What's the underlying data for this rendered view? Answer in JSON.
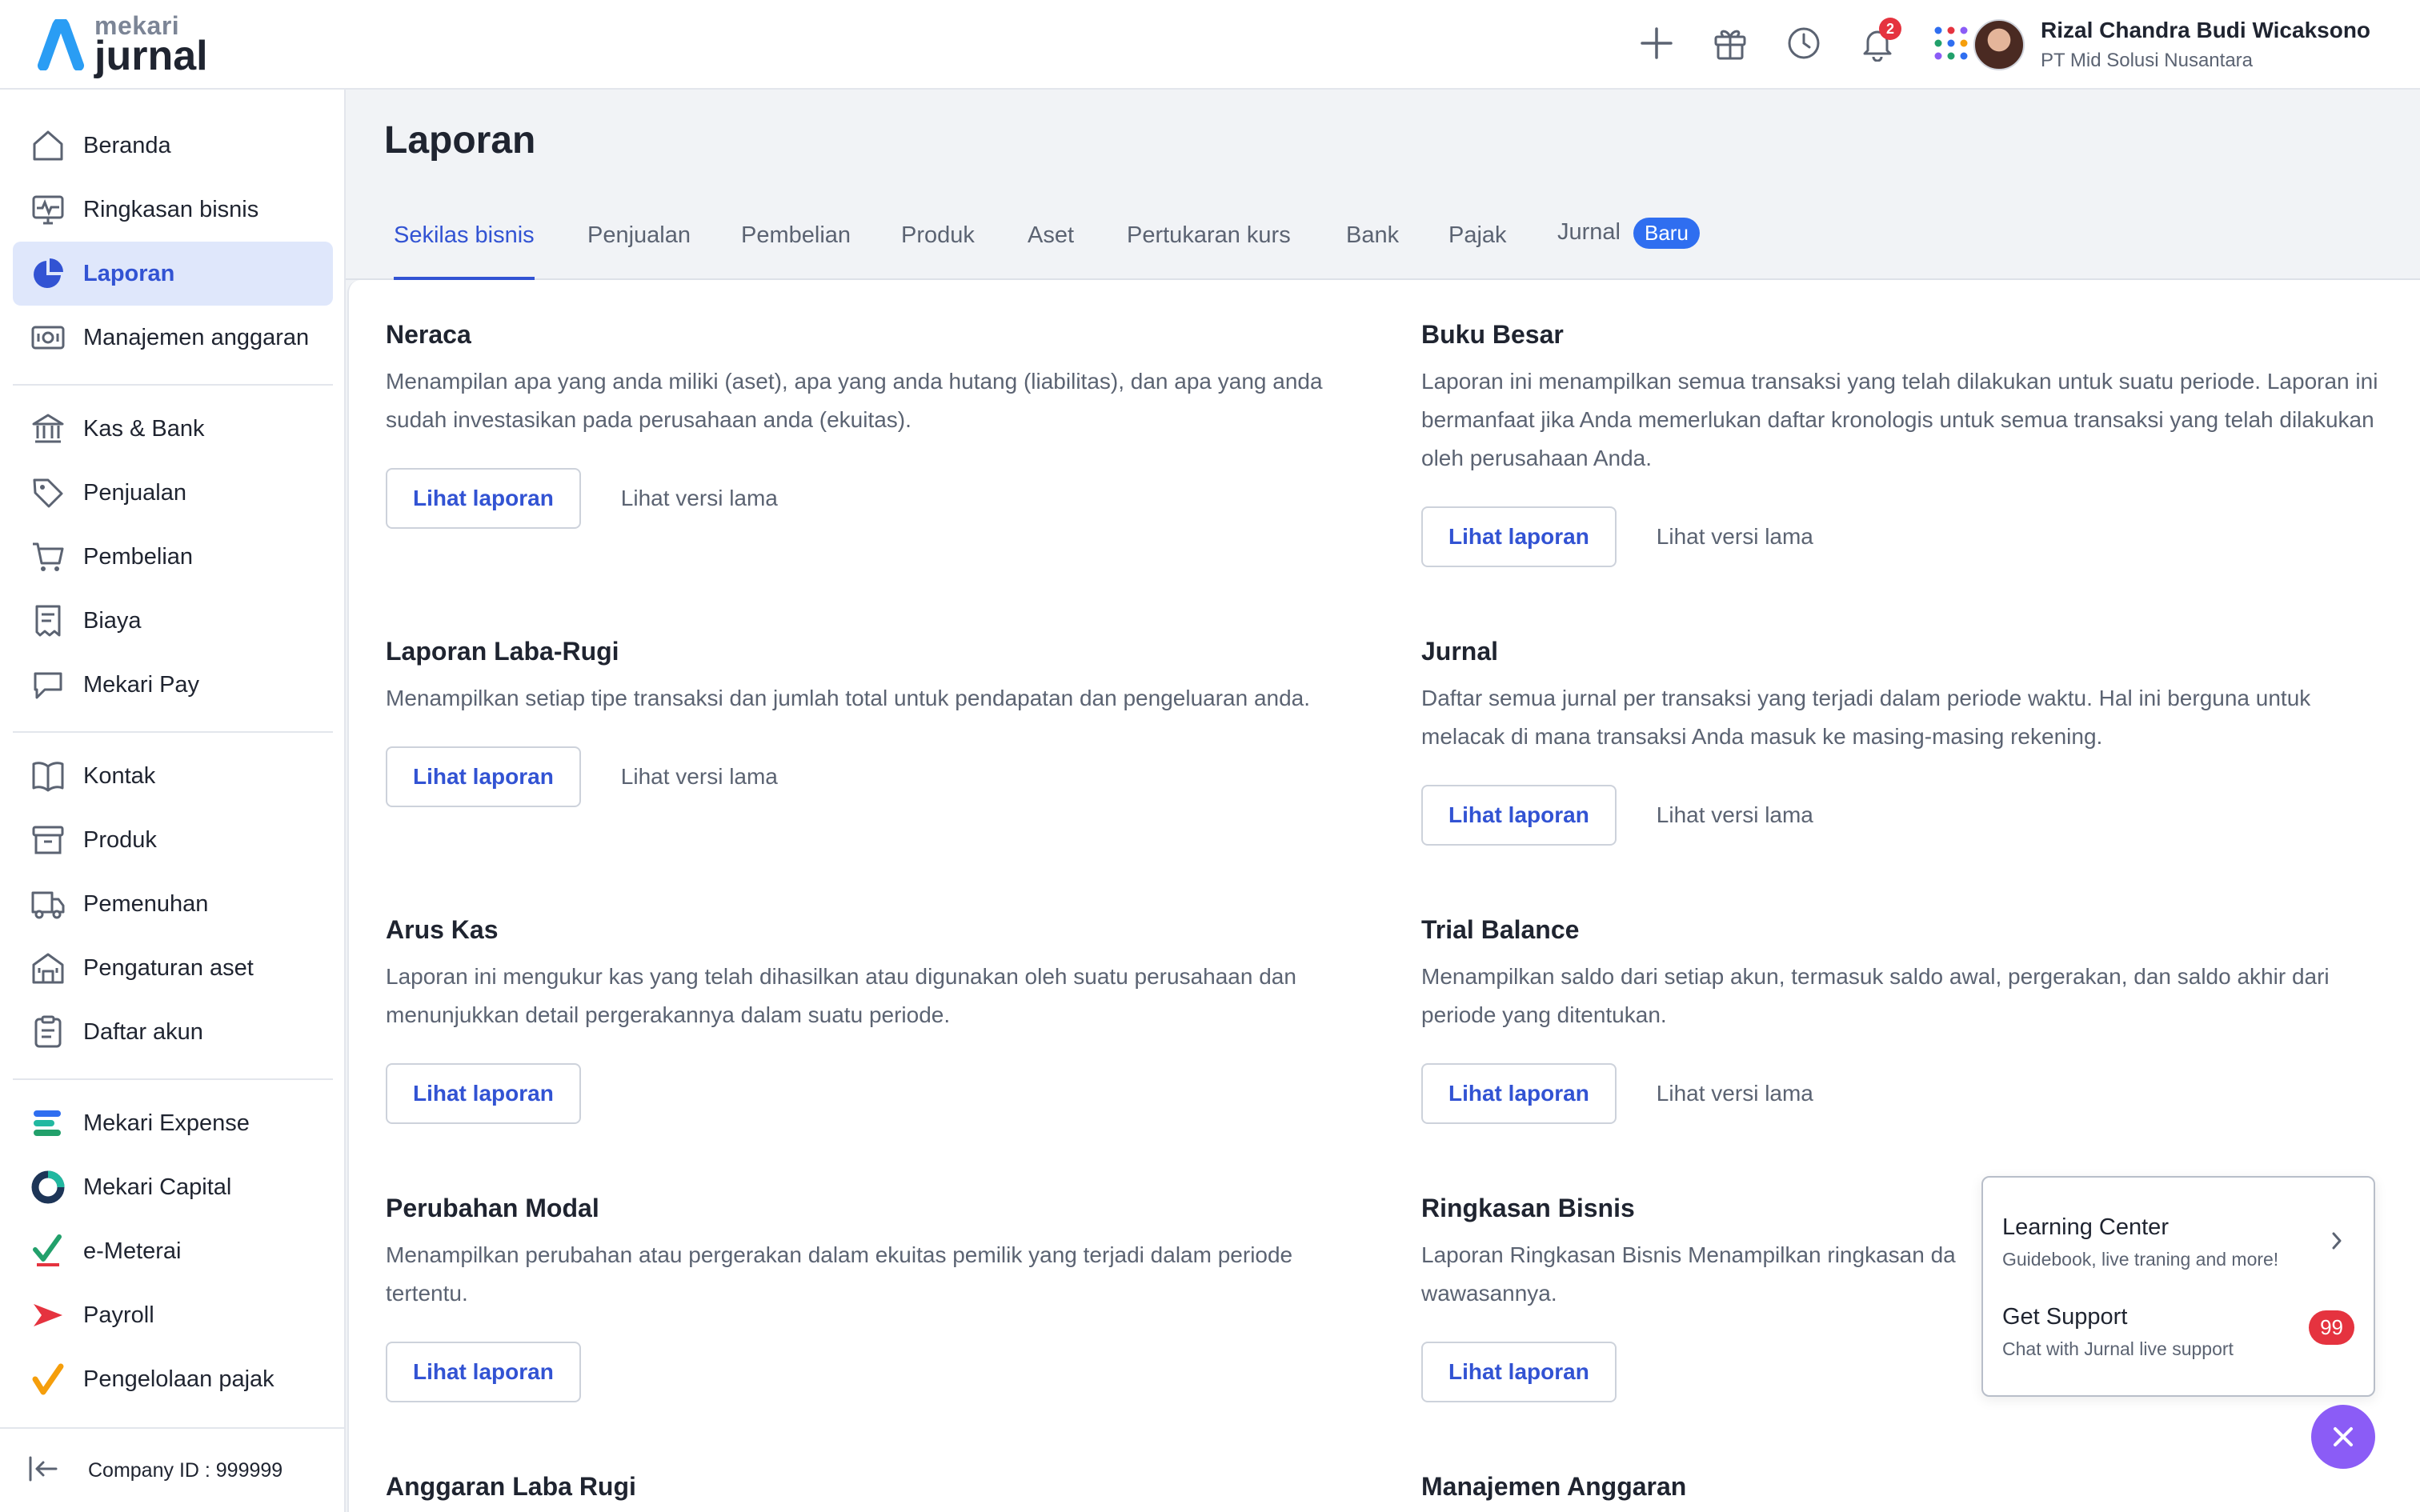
{
  "app": {
    "logo_top": "mekari",
    "logo_bottom": "jurnal",
    "notifications_count": "2"
  },
  "user": {
    "name": "Rizal Chandra Budi Wicaksono",
    "company": "PT Mid Solusi Nusantara"
  },
  "sidebar": {
    "items": [
      {
        "label": "Beranda",
        "icon": "home-icon"
      },
      {
        "label": "Ringkasan bisnis",
        "icon": "pulse-monitor-icon"
      },
      {
        "label": "Laporan",
        "icon": "pie-chart-icon",
        "active": true
      },
      {
        "label": "Manajemen anggaran",
        "icon": "budget-icon"
      },
      {
        "label": "Kas & Bank",
        "icon": "bank-icon"
      },
      {
        "label": "Penjualan",
        "icon": "tag-icon"
      },
      {
        "label": "Pembelian",
        "icon": "cart-icon"
      },
      {
        "label": "Biaya",
        "icon": "receipt-icon"
      },
      {
        "label": "Mekari Pay",
        "icon": "chat-bubble-icon"
      },
      {
        "label": "Kontak",
        "icon": "book-icon"
      },
      {
        "label": "Produk",
        "icon": "box-icon"
      },
      {
        "label": "Pemenuhan",
        "icon": "truck-icon"
      },
      {
        "label": "Pengaturan aset",
        "icon": "building-icon"
      },
      {
        "label": "Daftar akun",
        "icon": "clipboard-icon"
      },
      {
        "label": "Mekari Expense",
        "icon": "mekari-expense-icon"
      },
      {
        "label": "Mekari Capital",
        "icon": "mekari-capital-icon"
      },
      {
        "label": "e-Meterai",
        "icon": "e-meterai-icon"
      },
      {
        "label": "Payroll",
        "icon": "payroll-icon"
      },
      {
        "label": "Pengelolaan pajak",
        "icon": "pajak-icon"
      }
    ],
    "footer": {
      "company_id": "Company ID : 999999"
    }
  },
  "page": {
    "title": "Laporan",
    "tabs": [
      {
        "label": "Sekilas bisnis",
        "active": true
      },
      {
        "label": "Penjualan"
      },
      {
        "label": "Pembelian"
      },
      {
        "label": "Produk"
      },
      {
        "label": "Aset"
      },
      {
        "label": "Pertukaran kurs"
      },
      {
        "label": "Bank"
      },
      {
        "label": "Pajak"
      },
      {
        "label": "Jurnal",
        "badge": "Baru"
      }
    ]
  },
  "reports": [
    {
      "title": "Neraca",
      "desc": "Menampilan apa yang anda miliki (aset), apa yang anda hutang (liabilitas), dan apa yang anda sudah investasikan pada perusahaan anda (ekuitas).",
      "primary": "Lihat laporan",
      "secondary": "Lihat versi lama"
    },
    {
      "title": "Buku Besar",
      "desc": "Laporan ini menampilkan semua transaksi yang telah dilakukan untuk suatu periode. Laporan ini bermanfaat jika Anda memerlukan daftar kronologis untuk semua transaksi yang telah dilakukan oleh perusahaan Anda.",
      "primary": "Lihat laporan",
      "secondary": "Lihat versi lama"
    },
    {
      "title": "Laporan Laba-Rugi",
      "desc": "Menampilkan setiap tipe transaksi dan jumlah total untuk pendapatan dan pengeluaran anda.",
      "primary": "Lihat laporan",
      "secondary": "Lihat versi lama"
    },
    {
      "title": "Jurnal",
      "desc": "Daftar semua jurnal per transaksi yang terjadi dalam periode waktu. Hal ini berguna untuk melacak di mana transaksi Anda masuk ke masing-masing rekening.",
      "primary": "Lihat laporan",
      "secondary": "Lihat versi lama"
    },
    {
      "title": "Arus Kas",
      "desc": "Laporan ini mengukur kas yang telah dihasilkan atau digunakan oleh suatu perusahaan dan menunjukkan detail pergerakannya dalam suatu periode.",
      "primary": "Lihat laporan",
      "secondary": ""
    },
    {
      "title": "Trial Balance",
      "desc": "Menampilkan saldo dari setiap akun, termasuk saldo awal, pergerakan, dan saldo akhir dari periode yang ditentukan.",
      "primary": "Lihat laporan",
      "secondary": "Lihat versi lama"
    },
    {
      "title": "Perubahan Modal",
      "desc": "Menampilkan perubahan atau pergerakan dalam ekuitas pemilik yang terjadi dalam periode tertentu.",
      "primary": "Lihat laporan",
      "secondary": ""
    },
    {
      "title": "Ringkasan Bisnis",
      "desc": "Laporan Ringkasan Bisnis Menampilkan ringkasan da",
      "desc2": "wawasannya.",
      "primary": "Lihat laporan",
      "secondary": ""
    },
    {
      "title": "Anggaran Laba Rugi",
      "desc": "",
      "primary": "",
      "secondary": ""
    },
    {
      "title": "Manajemen Anggaran",
      "desc": "",
      "primary": "",
      "secondary": ""
    }
  ],
  "help": {
    "learning_title": "Learning Center",
    "learning_sub": "Guidebook, live traning and more!",
    "support_title": "Get Support",
    "support_sub": "Chat with Jurnal live support",
    "support_badge": "99"
  },
  "colors": {
    "accent": "#3253d3",
    "active_bg": "#dfe7fb",
    "badge_blue": "#2f6ef0",
    "badge_red": "#e5333f",
    "fab": "#8b5cf6"
  }
}
